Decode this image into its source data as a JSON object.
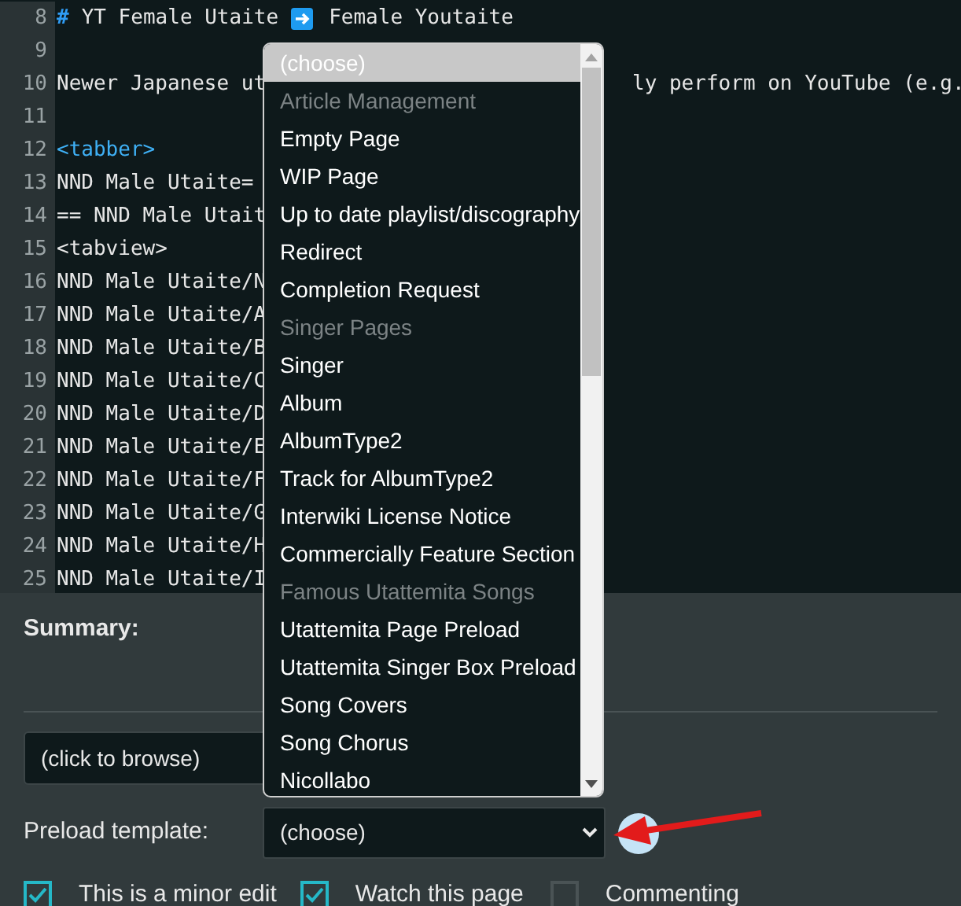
{
  "editor": {
    "lines": [
      {
        "number": "8",
        "kind": "heading",
        "text": "YT Female Utaite",
        "mark": "#",
        "after": "Female Youtaite"
      },
      {
        "number": "9",
        "kind": "plain"
      },
      {
        "number": "10",
        "kind": "plain",
        "text": "Newer Japanese ut",
        "right": "ly perform on YouTube (e.g."
      },
      {
        "number": "11",
        "kind": "plain"
      },
      {
        "number": "12",
        "kind": "tag",
        "text": "<tabber>"
      },
      {
        "number": "13",
        "kind": "plain",
        "text": "NND Male Utaite="
      },
      {
        "number": "14",
        "kind": "plain",
        "text": "== NND Male Utait"
      },
      {
        "number": "15",
        "kind": "plain",
        "text": "<tabview>"
      },
      {
        "number": "16",
        "kind": "plain",
        "text": "NND Male Utaite/N"
      },
      {
        "number": "17",
        "kind": "plain",
        "text": "NND Male Utaite/A"
      },
      {
        "number": "18",
        "kind": "plain",
        "text": "NND Male Utaite/B"
      },
      {
        "number": "19",
        "kind": "plain",
        "text": "NND Male Utaite/C"
      },
      {
        "number": "20",
        "kind": "plain",
        "text": "NND Male Utaite/D"
      },
      {
        "number": "21",
        "kind": "plain",
        "text": "NND Male Utaite/E"
      },
      {
        "number": "22",
        "kind": "plain",
        "text": "NND Male Utaite/F"
      },
      {
        "number": "23",
        "kind": "plain",
        "text": "NND Male Utaite/G"
      },
      {
        "number": "24",
        "kind": "plain",
        "text": "NND Male Utaite/H"
      },
      {
        "number": "25",
        "kind": "plain",
        "text": "NND Male Utaite/I"
      }
    ]
  },
  "summary": {
    "label": "Summary:"
  },
  "browse_field": {
    "value": "(click to browse)"
  },
  "preload": {
    "label": "Preload template:",
    "value": "(choose)"
  },
  "dropdown": {
    "options": [
      {
        "label": "(choose)",
        "kind": "option",
        "selected": true
      },
      {
        "label": "Article Management",
        "kind": "group",
        "selected": false
      },
      {
        "label": "Empty Page",
        "kind": "option",
        "selected": false
      },
      {
        "label": "WIP Page",
        "kind": "option",
        "selected": false
      },
      {
        "label": "Up to date playlist/discography",
        "kind": "option",
        "selected": false
      },
      {
        "label": "Redirect",
        "kind": "option",
        "selected": false
      },
      {
        "label": "Completion Request",
        "kind": "option",
        "selected": false
      },
      {
        "label": "Singer Pages",
        "kind": "group",
        "selected": false
      },
      {
        "label": "Singer",
        "kind": "option",
        "selected": false
      },
      {
        "label": "Album",
        "kind": "option",
        "selected": false
      },
      {
        "label": "AlbumType2",
        "kind": "option",
        "selected": false
      },
      {
        "label": "Track for AlbumType2",
        "kind": "option",
        "selected": false
      },
      {
        "label": "Interwiki License Notice",
        "kind": "option",
        "selected": false
      },
      {
        "label": "Commercially Feature Section",
        "kind": "option",
        "selected": false
      },
      {
        "label": "Famous Utattemita Songs",
        "kind": "group",
        "selected": false
      },
      {
        "label": "Utattemita Page Preload",
        "kind": "option",
        "selected": false
      },
      {
        "label": "Utattemita Singer Box Preload",
        "kind": "option",
        "selected": false
      },
      {
        "label": "Song Covers",
        "kind": "option",
        "selected": false
      },
      {
        "label": "Song Chorus",
        "kind": "option",
        "selected": false
      },
      {
        "label": "Nicollabo",
        "kind": "option",
        "selected": false
      }
    ]
  },
  "checkboxes": [
    {
      "label": "This is a minor edit",
      "checked": true
    },
    {
      "label": "Watch this page",
      "checked": true
    },
    {
      "label": "Commenting",
      "checked": false
    }
  ]
}
